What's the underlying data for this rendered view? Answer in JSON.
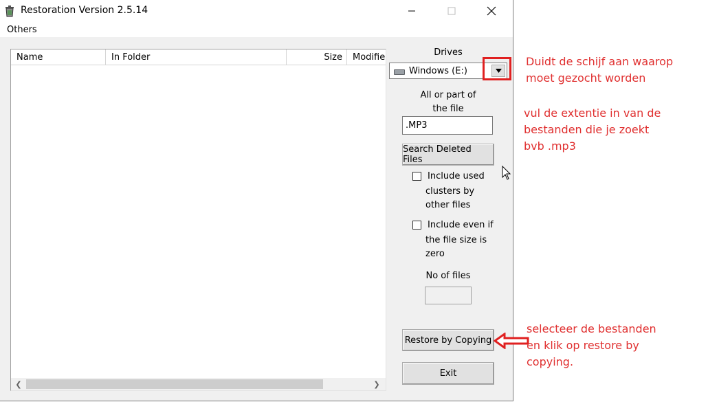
{
  "window": {
    "title": "Restoration Version 2.5.14",
    "minimize_glyph": "—",
    "maximize_glyph": "☐",
    "close_glyph": "✕"
  },
  "menu": {
    "items": [
      {
        "label": "Others"
      }
    ]
  },
  "file_list": {
    "columns": [
      {
        "label": "Name"
      },
      {
        "label": "In Folder"
      },
      {
        "label": "Size"
      },
      {
        "label": "Modified"
      }
    ],
    "rows": []
  },
  "drives": {
    "label": "Drives",
    "selected": "Windows (E:)",
    "icon": "drive-icon"
  },
  "search": {
    "label_line1": "All or part of",
    "label_line2": "the file",
    "value": ".MP3",
    "button_label": "Search Deleted Files"
  },
  "options": {
    "include_used_clusters": {
      "checked": false,
      "line1": "Include used",
      "line2": "clusters by",
      "line3": "other files"
    },
    "include_zero_size": {
      "checked": false,
      "line1": "Include even if",
      "line2": "the file size is",
      "line3": "zero"
    }
  },
  "file_count": {
    "label": "No of files",
    "value": ""
  },
  "actions": {
    "restore_label": "Restore by Copying",
    "exit_label": "Exit"
  },
  "annotations": {
    "drive_note_line1": "Duidt de schijf aan waarop",
    "drive_note_line2": "moet gezocht worden",
    "ext_note_line1": "vul de extentie in van de",
    "ext_note_line2": "bestanden die je zoekt",
    "ext_note_line3": "bvb .mp3",
    "restore_note_line1": "selecteer de bestanden",
    "restore_note_line2": "en klik op restore by",
    "restore_note_line3": "copying.",
    "color": "#e03030"
  }
}
